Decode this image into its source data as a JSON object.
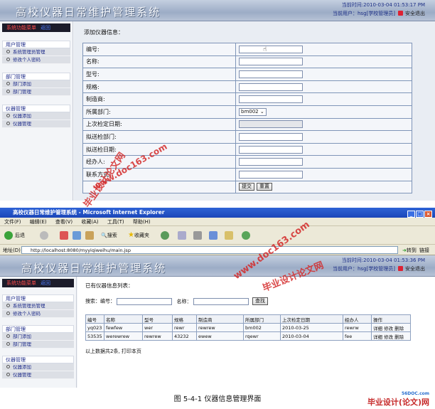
{
  "app": {
    "system_name": "高校仪器日常维护管理系统",
    "current_user": "当前用户：hsg[学校管理员]",
    "logout": "安全退出"
  },
  "sidebar": {
    "header": "系统功能菜单",
    "header_link": "返回",
    "groups": [
      {
        "title": "用户管理",
        "items": [
          "系统管理员管理",
          "修改个人密码"
        ]
      },
      {
        "title": "部门管理",
        "items": [
          "部门添加",
          "部门管理"
        ]
      },
      {
        "title": "仪器管理",
        "items": [
          "仪器添加",
          "仪器管理"
        ]
      }
    ]
  },
  "top_screen": {
    "time": "当前时间:2010-03-04 01:53:17 PM",
    "form_title": "添加仪器信息：",
    "fields": [
      {
        "label": "编号:"
      },
      {
        "label": "名称:"
      },
      {
        "label": "型号:"
      },
      {
        "label": "规格:"
      },
      {
        "label": "制造商:"
      },
      {
        "label": "所属部门:",
        "select_value": "bm002"
      },
      {
        "label": "上次检定日期:"
      },
      {
        "label": "拟送检部门:"
      },
      {
        "label": "拟送检日期:"
      },
      {
        "label": "经办人:"
      },
      {
        "label": "联系方式:"
      }
    ],
    "submit": "提交",
    "reset": "重置"
  },
  "browser": {
    "title": "高校仪器日常维护管理系统 - Microsoft Internet Explorer",
    "menu": [
      "文件(F)",
      "编辑(E)",
      "查看(V)",
      "收藏(A)",
      "工具(T)",
      "帮助(H)"
    ],
    "back": "后退",
    "search": "搜索",
    "favorites": "收藏夹",
    "address_label": "地址(D)",
    "address": "http://localhost:8080/myyiqiweihu/main.jsp",
    "go": "转到",
    "links": "链接"
  },
  "list_screen": {
    "time": "当前时间:2010-03-04 01:53:36 PM",
    "title": "已有仪器信息列表：",
    "search_id_label": "搜索：编号：",
    "search_name_label": "名称：",
    "search_button": "查找",
    "columns": [
      "编号",
      "名称",
      "型号",
      "规格",
      "制造商",
      "所属部门",
      "上次检定日期",
      "经办人",
      "操作"
    ],
    "rows": [
      [
        "yq023",
        "fewfew",
        "wer",
        "rewr",
        "rewrew",
        "bm002",
        "2010-03-25",
        "rewrw",
        "详细 修改 删除"
      ],
      [
        "53535",
        "werewrew",
        "rewrew",
        "43232",
        "ewew",
        "rqewr",
        "2010-03-04",
        "fee",
        "详细 修改 删除"
      ]
    ],
    "summary": "以上数据共2条, 打印本页"
  },
  "figure_caption": "图 5-4-1 仪器信息管理界面",
  "watermarks": [
    "毕业设计论文网",
    "www.doc163.com"
  ],
  "brand_logo": "毕业设计(论文)网",
  "brand_url": "56DOC.com",
  "colors": {
    "header": "#9cacc6",
    "link_blue": "#1e2c8a",
    "watermark_red": "#d42a2a"
  }
}
